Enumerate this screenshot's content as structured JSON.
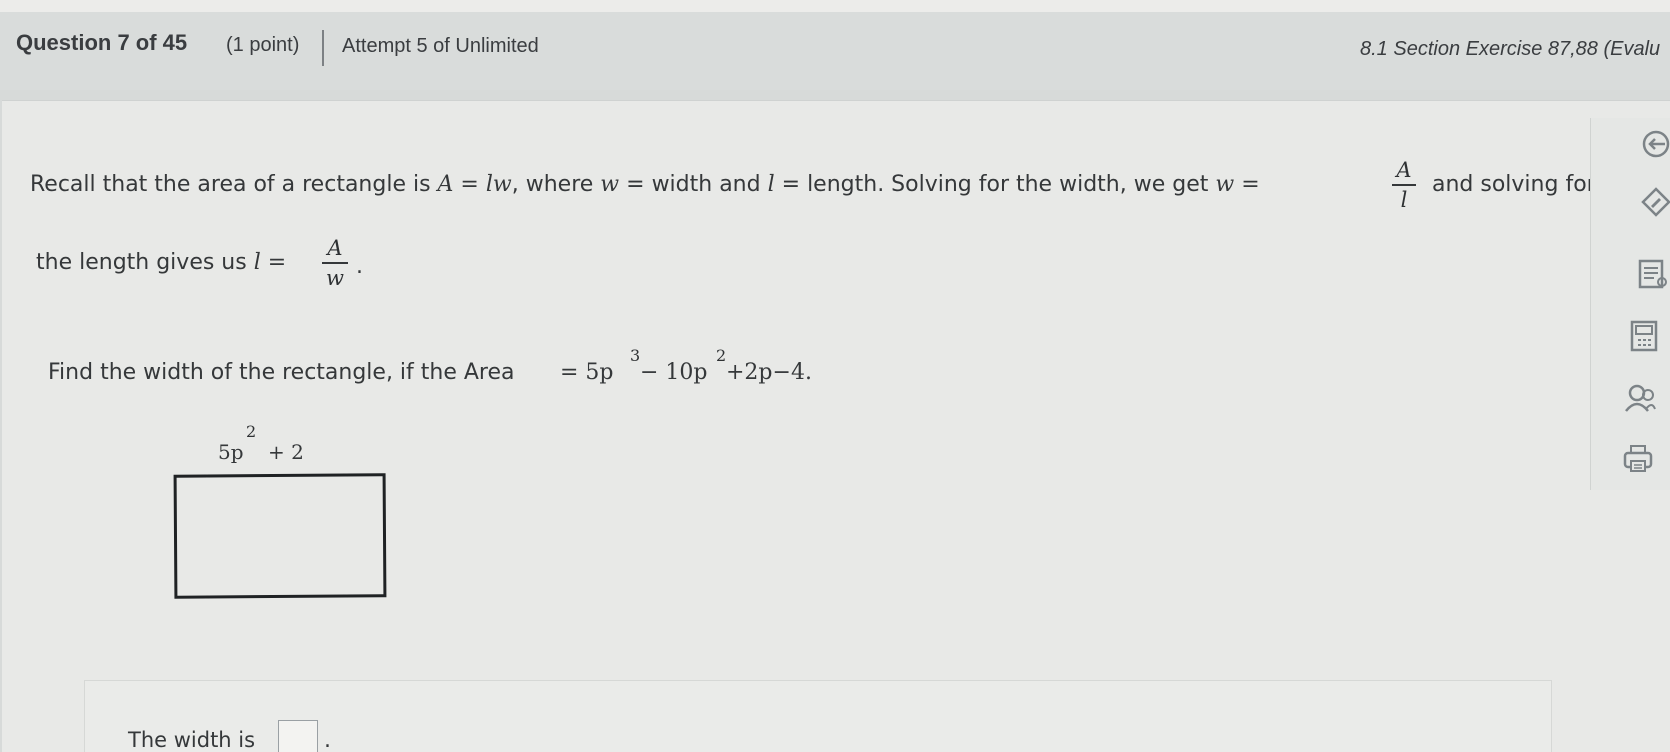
{
  "header": {
    "question_label": "Question 7 of 45",
    "points": "(1 point)",
    "attempt": "Attempt 5 of Unlimited",
    "section": "8.1 Section Exercise 87,88 (Evalu"
  },
  "problem": {
    "line1_a": "Recall that the area of a rectangle is",
    "line1_formula": "A = lw",
    "line1_b": ", where",
    "line1_w": "w",
    "line1_c": "= width and",
    "line1_l": "l",
    "line1_d": "= length. Solving for the width, we get",
    "line1_w2": "w =",
    "frac1_num": "A",
    "frac1_den": "l",
    "line1_e": "and solving for",
    "line2_a": "the length gives us",
    "line2_l": "l =",
    "frac2_num": "A",
    "frac2_den": "w",
    "line2_end": ".",
    "find_text": "Find the width of the rectangle, if the Area",
    "area_expr_a": "= 5p",
    "area_exp1": "3",
    "area_expr_b": "− 10p",
    "area_exp2": "2",
    "area_expr_c": "+2p−4.",
    "side_label_a": "5p",
    "side_exp": "2",
    "side_label_b": "+ 2"
  },
  "answer": {
    "prompt": "The width is",
    "value": "",
    "end": "."
  },
  "toolbar": {
    "icons": [
      "refresh-icon",
      "edit-icon",
      "notes-icon",
      "calculator-icon",
      "help-person-icon",
      "print-icon"
    ]
  }
}
